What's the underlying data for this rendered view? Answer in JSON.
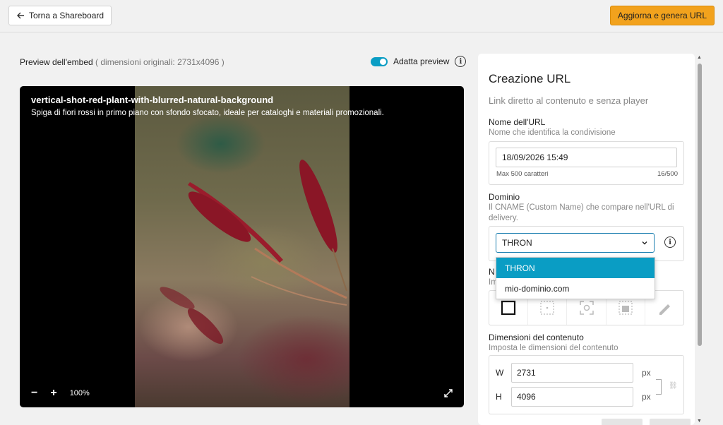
{
  "topbar": {
    "back_label": "Torna a Shareboard",
    "primary_label": "Aggiorna e genera URL"
  },
  "preview": {
    "title": "Preview dell'embed",
    "subtitle": "( dimensioni originali: 2731x4096 )",
    "toggle_label": "Adatta preview",
    "toggle_on": true,
    "asset_title": "vertical-shot-red-plant-with-blurred-natural-background",
    "asset_description": "Spiga di fiori rossi in primo piano con sfondo sfocato, ideale per cataloghi e materiali promozionali.",
    "zoom_minus": "−",
    "zoom_plus": "+",
    "zoom_level": "100%"
  },
  "panel": {
    "heading": "Creazione URL",
    "lead": "Link diretto al contenuto e senza player",
    "name_section": {
      "label": "Nome dell'URL",
      "hint": "Nome che identifica la condivisione",
      "value": "18/09/2026 15:49",
      "max_label": "Max 500 caratteri",
      "counter": "16/500"
    },
    "domain_section": {
      "label": "Dominio",
      "hint": "Il CNAME (Custom Name) che compare nell'URL di delivery.",
      "selected": "THRON",
      "options": [
        "THRON",
        "mio-dominio.com"
      ]
    },
    "hidden_section": {
      "label_visible": "N",
      "hint_visible": "Im"
    },
    "dimensions_section": {
      "label": "Dimensioni del contenuto",
      "hint": "Imposta le dimensioni del contenuto",
      "w_letter": "W",
      "h_letter": "H",
      "w_value": "2731",
      "h_value": "4096",
      "unit": "px"
    }
  },
  "colors": {
    "accent": "#0a9dc4",
    "primary_button": "#f2a21d",
    "select_border": "#1c7fb0"
  }
}
